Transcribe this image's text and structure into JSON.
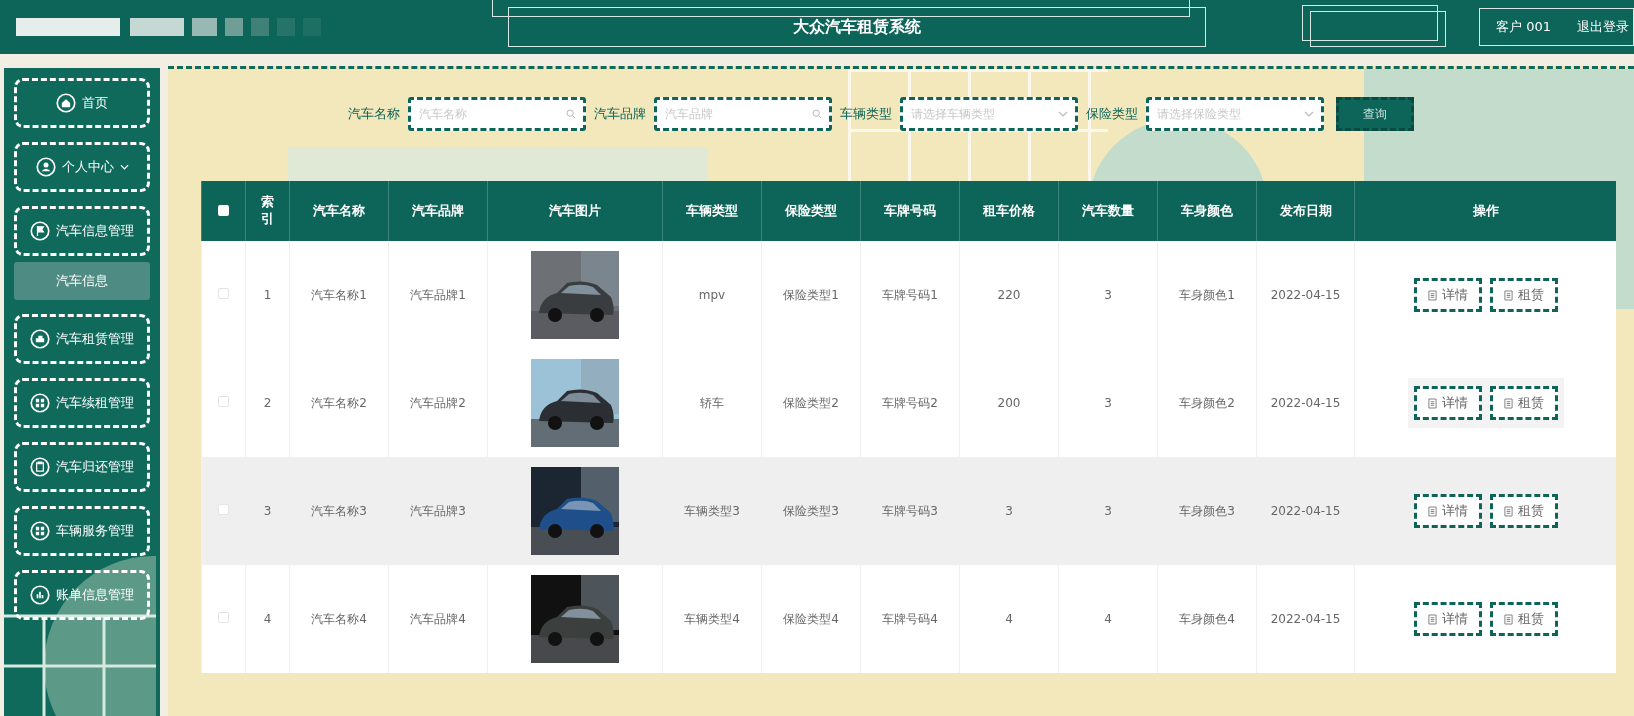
{
  "header": {
    "title": "大众汽车租赁系统",
    "user": "客户 001",
    "logout": "退出登录"
  },
  "sidebar": {
    "items": [
      {
        "label": "首页"
      },
      {
        "label": "个人中心",
        "expanded": false
      },
      {
        "label": "汽车信息管理",
        "expanded": true,
        "children": [
          {
            "label": "汽车信息",
            "selected": true
          }
        ]
      },
      {
        "label": "汽车租赁管理"
      },
      {
        "label": "汽车续租管理"
      },
      {
        "label": "汽车归还管理"
      },
      {
        "label": "车辆服务管理"
      },
      {
        "label": "账单信息管理"
      }
    ]
  },
  "search": {
    "fields": [
      {
        "label": "汽车名称",
        "placeholder": "汽车名称",
        "kind": "text"
      },
      {
        "label": "汽车品牌",
        "placeholder": "汽车品牌",
        "kind": "text"
      },
      {
        "label": "车辆类型",
        "placeholder": "请选择车辆类型",
        "kind": "select"
      },
      {
        "label": "保险类型",
        "placeholder": "请选择保险类型",
        "kind": "select"
      }
    ],
    "button": "查询"
  },
  "table": {
    "select_all_checked": false,
    "columns": [
      "索引",
      "汽车名称",
      "汽车品牌",
      "汽车图片",
      "车辆类型",
      "保险类型",
      "车牌号码",
      "租车价格",
      "汽车数量",
      "车身颜色",
      "发布日期",
      "操作"
    ],
    "rows": [
      {
        "checked": false,
        "highlighted": false,
        "cells": [
          "1",
          "汽车名称1",
          "汽车品牌1",
          {
            "kind": "picture"
          },
          "mpv",
          "保险类型1",
          "车牌号码1",
          "220",
          "3",
          "车身颜色1",
          "2022-04-15"
        ],
        "actions": [
          "详情",
          "租赁"
        ]
      },
      {
        "checked": false,
        "highlighted": false,
        "cells": [
          "2",
          "汽车名称2",
          "汽车品牌2",
          {
            "kind": "picture"
          },
          "轿车",
          "保险类型2",
          "车牌号码2",
          "200",
          "3",
          "车身颜色2",
          "2022-04-15"
        ],
        "actions": [
          "详情",
          "租赁"
        ]
      },
      {
        "checked": false,
        "highlighted": true,
        "cells": [
          "3",
          "汽车名称3",
          "汽车品牌3",
          {
            "kind": "picture"
          },
          "车辆类型3",
          "保险类型3",
          "车牌号码3",
          "3",
          "3",
          "车身颜色3",
          "2022-04-15"
        ],
        "actions": [
          "详情",
          "租赁"
        ]
      },
      {
        "checked": false,
        "highlighted": false,
        "cells": [
          "4",
          "汽车名称4",
          "汽车品牌4",
          {
            "kind": "picture"
          },
          "车辆类型4",
          "保险类型4",
          "车牌号码4",
          "4",
          "4",
          "车身颜色4",
          "2022-04-15"
        ],
        "actions": [
          "详情",
          "租赁"
        ]
      }
    ]
  }
}
